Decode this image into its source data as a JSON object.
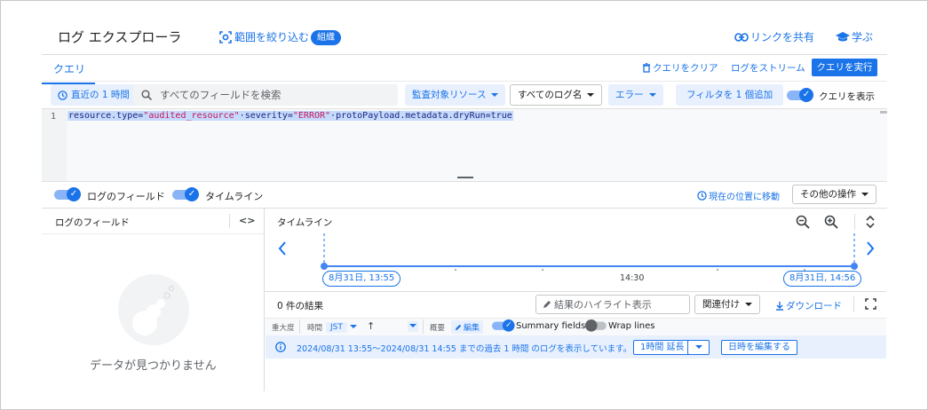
{
  "header": {
    "title": "ログ エクスプローラ",
    "scope_label": "範囲を絞り込む",
    "scope_badge": "組織",
    "share_label": "リンクを共有",
    "learn_label": "学ぶ"
  },
  "tabs": {
    "query_tab": "クエリ",
    "clear_query": "クエリをクリア",
    "stream_logs": "ログをストリーム",
    "run_query": "クエリを実行"
  },
  "toolbar": {
    "time_range": "直近の 1 時間",
    "search_placeholder": "すべてのフィールドを検索",
    "resource_filter": "監査対象リソース",
    "log_name_filter": "すべてのログ名",
    "severity_filter": "エラー",
    "add_filter": "フィルタを 1 個追加",
    "show_query_label": "クエリを表示"
  },
  "editor": {
    "line_number": "1",
    "code_part1": "resource.type=",
    "code_str1": "\"audited_resource\"",
    "code_part2": "·severity=",
    "code_str2": "\"ERROR\"",
    "code_part3": "·protoPayload.metadata.dryRun=true"
  },
  "options": {
    "log_fields_toggle": "ログのフィールド",
    "timeline_toggle": "タイムライン",
    "jump_to_now": "現在の位置に移動",
    "more_actions": "その他の操作"
  },
  "log_fields_panel": {
    "title": "ログのフィールド",
    "empty_text": "データが見つかりません"
  },
  "timeline": {
    "title": "タイムライン",
    "start_label": "8月31日, 13:55",
    "mid_label": "14:30",
    "end_label": "8月31日, 14:56"
  },
  "results": {
    "count": "0 件の結果",
    "highlight_placeholder": "結果のハイライト表示",
    "correlate": "関連付け",
    "download": "ダウンロード"
  },
  "columns": {
    "severity": "重大度",
    "time": "時間",
    "timezone": "JST",
    "summary": "概要",
    "edit": "編集",
    "summary_fields": "Summary fields",
    "wrap_lines": "Wrap lines"
  },
  "banner": {
    "message": "2024/08/31 13:55〜2024/08/31 14:55 までの過去 1 時間 のログを表示しています。",
    "extend": "1時間 延長",
    "edit_time": "日時を編集する"
  },
  "colors": {
    "accent": "#1a73e8",
    "accent_light": "#e8f0fe"
  }
}
